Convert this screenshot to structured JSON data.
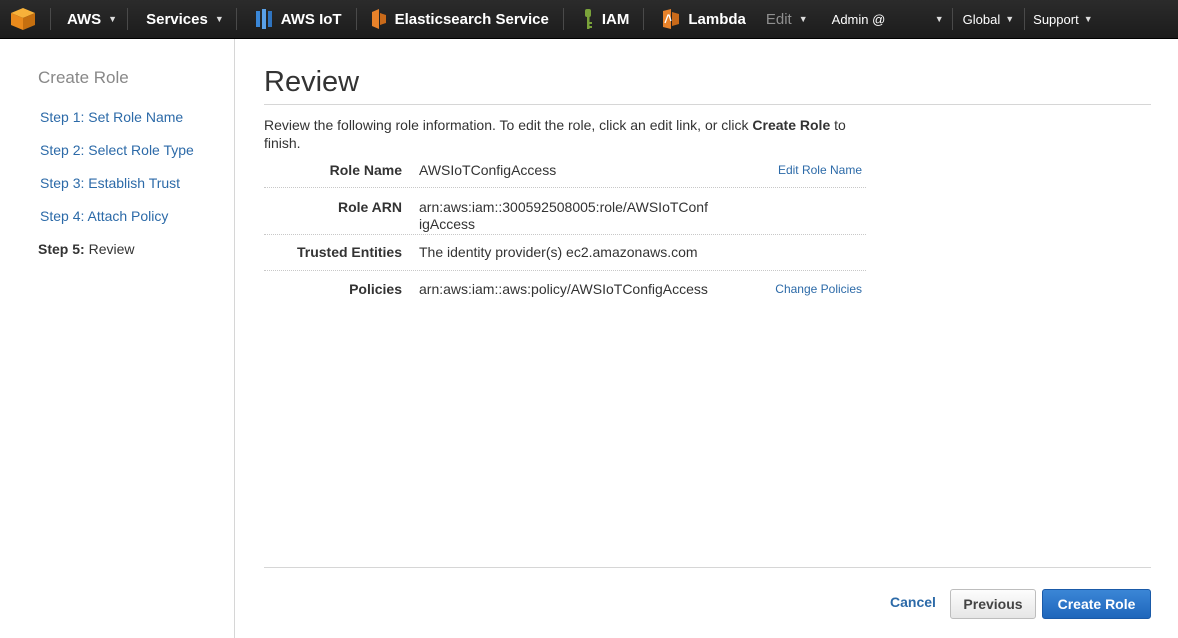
{
  "nav": {
    "aws_label": "AWS",
    "services_label": "Services",
    "iot_label": "AWS IoT",
    "es_label": "Elasticsearch Service",
    "iam_label": "IAM",
    "lambda_label": "Lambda",
    "edit_label": "Edit",
    "account_label": "Admin @",
    "region_label": "Global",
    "support_label": "Support",
    "colors": {
      "bar": "#232323",
      "cube": "#f39c12",
      "iot": "#3a87d8",
      "es": "#e8822a",
      "iam": "#7aa33a",
      "lambda": "#e8822a"
    }
  },
  "sidebar": {
    "title": "Create Role",
    "steps": [
      {
        "label": "Step 1: Set Role Name"
      },
      {
        "label": "Step 2: Select Role Type"
      },
      {
        "label": "Step 3: Establish Trust"
      },
      {
        "label": "Step 4: Attach Policy"
      },
      {
        "prefix": "Step 5:",
        "label": "Review"
      }
    ]
  },
  "main": {
    "title": "Review",
    "intro_before": "Review the following role information. To edit the role, click an edit link, or click ",
    "intro_bold": "Create Role",
    "intro_after": " to finish.",
    "rows": [
      {
        "label": "Role Name",
        "value": "AWSIoTConfigAccess",
        "link": "Edit Role Name"
      },
      {
        "label": "Role ARN",
        "value": "arn:aws:iam::300592508005:role/AWSIoTConfigAccess"
      },
      {
        "label": "Trusted Entities",
        "value": "The identity provider(s) ec2.amazonaws.com"
      },
      {
        "label": "Policies",
        "value": "arn:aws:iam::aws:policy/AWSIoTConfigAccess",
        "link": "Change Policies"
      }
    ]
  },
  "footer": {
    "cancel_label": "Cancel",
    "previous_label": "Previous",
    "create_label": "Create Role"
  }
}
